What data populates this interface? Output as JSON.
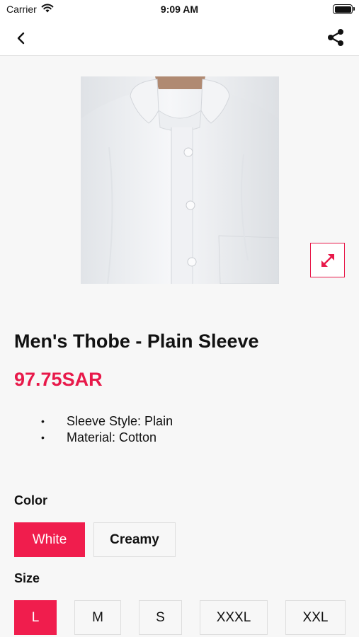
{
  "status_bar": {
    "carrier": "Carrier",
    "time": "9:09 AM"
  },
  "nav": {
    "back_icon": "chevron-left-icon",
    "share_icon": "share-icon"
  },
  "product": {
    "expand_icon": "expand-arrows-icon",
    "title": "Men's Thobe - Plain Sleeve",
    "price": "97.75SAR",
    "features": [
      "Sleeve Style: Plain",
      "Material: Cotton"
    ]
  },
  "color": {
    "label": "Color",
    "selected": "White",
    "options": [
      "White",
      "Creamy"
    ]
  },
  "size": {
    "label": "Size",
    "selected": "L",
    "options": [
      "L",
      "M",
      "S",
      "XXXL",
      "XXL"
    ]
  },
  "colors": {
    "accent": "#f01d4d",
    "background": "#f7f7f7"
  }
}
